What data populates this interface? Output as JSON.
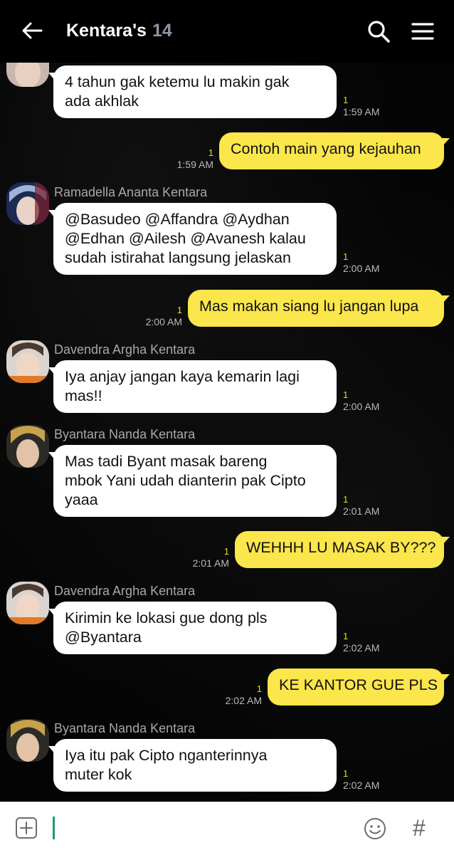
{
  "header": {
    "title": "Kentara's",
    "member_count": "14"
  },
  "messages": [
    {
      "direction": "in",
      "sender": "",
      "lines": [
        "4 tahun gak ketemu lu makin gak",
        "ada akhlak"
      ],
      "read": "1",
      "time": "1:59 AM"
    },
    {
      "direction": "out",
      "lines": [
        "Contoh main yang kejauhan"
      ],
      "read": "1",
      "time": "1:59 AM"
    },
    {
      "direction": "in",
      "sender": "Ramadella Ananta Kentara",
      "lines": [
        "@Basudeo @Affandra @Aydhan",
        "@Edhan @Ailesh @Avanesh kalau",
        "sudah istirahat langsung jelaskan"
      ],
      "read": "1",
      "time": "2:00 AM"
    },
    {
      "direction": "out",
      "lines": [
        "Mas makan siang lu jangan lupa"
      ],
      "read": "1",
      "time": "2:00 AM"
    },
    {
      "direction": "in",
      "sender": "Davendra Argha Kentara",
      "lines": [
        "Iya anjay jangan kaya kemarin lagi",
        "mas!!"
      ],
      "read": "1",
      "time": "2:00 AM"
    },
    {
      "direction": "in",
      "sender": "Byantara Nanda Kentara",
      "lines": [
        "Mas tadi Byant masak bareng",
        "mbok Yani udah dianterin pak Cipto",
        "yaaa"
      ],
      "read": "1",
      "time": "2:01 AM"
    },
    {
      "direction": "out",
      "lines": [
        "WEHHH LU MASAK BY???"
      ],
      "read": "1",
      "time": "2:01 AM"
    },
    {
      "direction": "in",
      "sender": "Davendra Argha Kentara",
      "lines": [
        "Kirimin ke lokasi gue dong pls",
        "@Byantara"
      ],
      "read": "1",
      "time": "2:02 AM"
    },
    {
      "direction": "out",
      "lines": [
        "KE KANTOR GUE PLS"
      ],
      "read": "1",
      "time": "2:02 AM"
    },
    {
      "direction": "in",
      "sender": "Byantara Nanda Kentara",
      "lines": [
        "Iya itu pak Cipto nganterinnya",
        "muter kok"
      ],
      "read": "1",
      "time": "2:02 AM"
    }
  ],
  "input": {
    "value": "",
    "plus_icon": "plus-box-icon",
    "emoji_icon": "smiley-icon",
    "hash_label": "#"
  },
  "colors": {
    "outgoing_bubble": "#fbe64b",
    "incoming_bubble": "#ffffff",
    "read_count": "#e8d82a",
    "background": "#050505"
  }
}
